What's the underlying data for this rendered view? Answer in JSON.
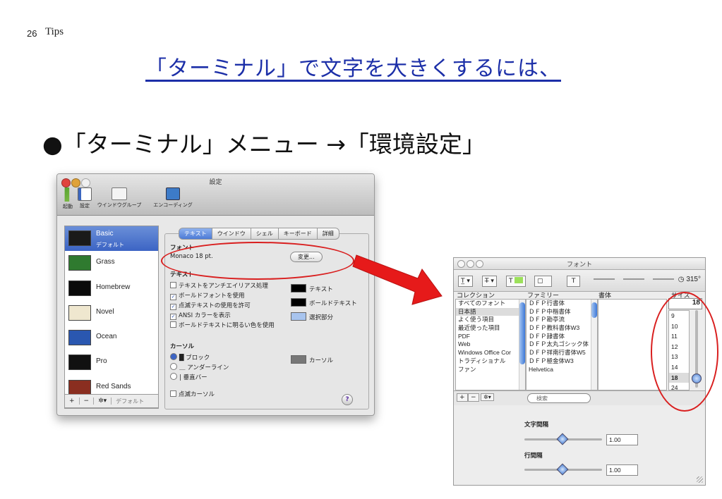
{
  "slide": {
    "number": "26",
    "label": "Tips",
    "title": "「ターミナル」で文字を大きくするには、",
    "heading": "●「ターミナル」メニュー →「環境設定」"
  },
  "settings_window": {
    "title": "設定",
    "toolbar": [
      "起動",
      "設定",
      "ウインドウグループ",
      "エンコーディング"
    ],
    "profiles": [
      {
        "name": "Basic",
        "sub": "デフォルト",
        "color": "#1a1a1a"
      },
      {
        "name": "Grass",
        "sub": "",
        "color": "#2f7a2f"
      },
      {
        "name": "Homebrew",
        "sub": "",
        "color": "#0a0a0a"
      },
      {
        "name": "Novel",
        "sub": "",
        "color": "#efe7cf"
      },
      {
        "name": "Ocean",
        "sub": "",
        "color": "#2a57b0"
      },
      {
        "name": "Pro",
        "sub": "",
        "color": "#111111"
      },
      {
        "name": "Red Sands",
        "sub": "",
        "color": "#8a2e20"
      }
    ],
    "footer": {
      "add": "+",
      "remove": "−",
      "gear": "✲▾",
      "default": "デフォルト"
    },
    "tabs": [
      "テキスト",
      "ウインドウ",
      "シェル",
      "キーボード",
      "詳細"
    ],
    "font_heading": "フォント",
    "font_value": "Monaco 18 pt.",
    "change_button": "変更...",
    "text_heading": "テキスト",
    "text_options": [
      {
        "label": "テキストをアンチエイリアス処理",
        "checked": false
      },
      {
        "label": "ボールドフォントを使用",
        "checked": true
      },
      {
        "label": "点滅テキストの使用を許可",
        "checked": true
      },
      {
        "label": "ANSI カラーを表示",
        "checked": true
      },
      {
        "label": "ボールドテキストに明るい色を使用",
        "checked": false
      }
    ],
    "color_labels": [
      "テキスト",
      "ボールドテキスト",
      "選択部分"
    ],
    "cursor_heading": "カーソル",
    "cursor_options": [
      {
        "label": "█ ブロック",
        "selected": true
      },
      {
        "label": "＿ アンダーライン",
        "selected": false
      },
      {
        "label": "| 垂直バー",
        "selected": false
      }
    ],
    "cursor_color_label": "カーソル",
    "blink_cursor": "点滅カーソル",
    "help": "?"
  },
  "font_window": {
    "title": "フォント",
    "rotation": "315°",
    "columns": [
      "コレクション",
      "ファミリー",
      "書体",
      "サイズ"
    ],
    "collections": [
      "すべてのフォント",
      "日本語",
      "よく使う項目",
      "最近使った項目",
      "PDF",
      "Web",
      "Windows Office Cor",
      "トラディショナル",
      "ファン"
    ],
    "selected_collection": 1,
    "families": [
      "ＤＦＰ行書体",
      "ＤＦＰ中楷書体",
      "ＤＦＰ勘亭流",
      "ＤＦＰ教科書体W3",
      "ＤＦＰ隷書体",
      "ＤＦＰ太丸ゴシック体",
      "ＤＦＰ祥南行書体W5",
      "ＤＦＰ極金体W3",
      "Helvetica"
    ],
    "size_value": "18",
    "sizes": [
      "9",
      "10",
      "11",
      "12",
      "13",
      "14",
      "18",
      "24"
    ],
    "selected_size": 6,
    "search_placeholder": "検索",
    "char_spacing_label": "文字間隔",
    "char_spacing_value": "1.00",
    "line_spacing_label": "行間隔",
    "line_spacing_value": "1.00"
  },
  "colors": {
    "title_blue": "#1c2fa8",
    "annotation_red": "#d91f1f"
  }
}
